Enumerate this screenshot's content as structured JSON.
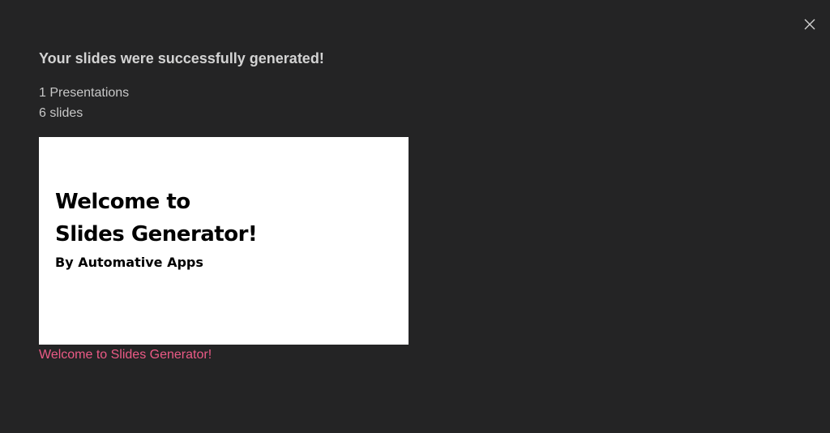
{
  "dialog": {
    "title": "Your slides were successfully generated!",
    "close_icon": "close-icon",
    "summary": {
      "presentations": "1 Presentations",
      "slides": "6 slides"
    }
  },
  "presentation": {
    "thumbnail": {
      "title_line1": "Welcome to",
      "title_line2": "Slides Generator!",
      "subtitle": "By Automative Apps"
    },
    "link_label": "Welcome to Slides Generator!"
  },
  "colors": {
    "background": "#242425",
    "text": "#d3d3d3",
    "link": "#ec5a86",
    "thumbnail_bg": "#ffffff"
  }
}
